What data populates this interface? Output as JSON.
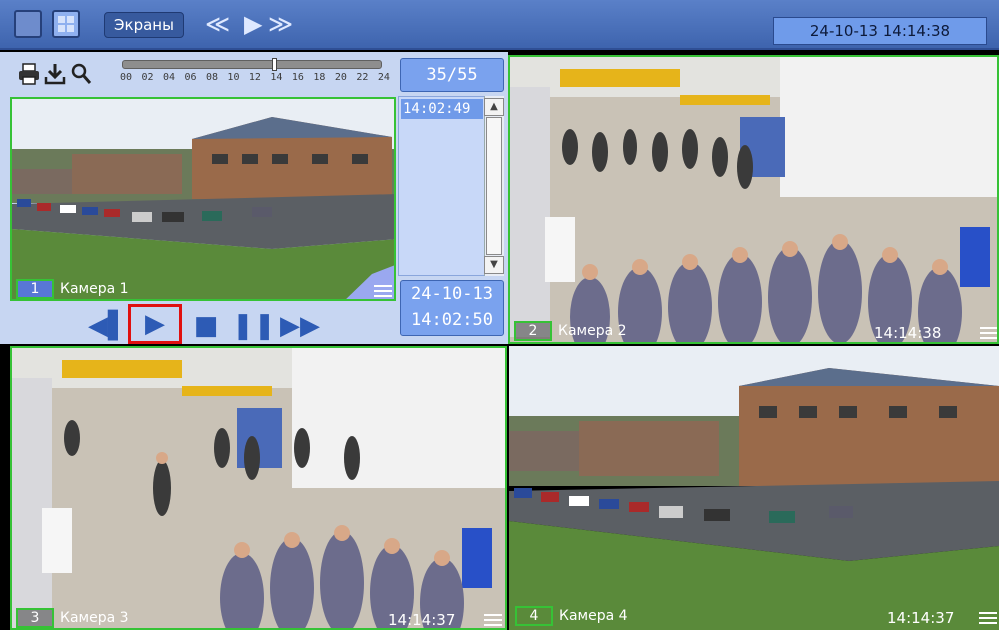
{
  "toolbar": {
    "screens_label": "Экраны",
    "datetime": "24-10-13  14:14:38"
  },
  "playback": {
    "counter": "35/55",
    "timeline_ticks": [
      "00",
      "02",
      "04",
      "06",
      "08",
      "10",
      "12",
      "14",
      "16",
      "18",
      "20",
      "22",
      "24"
    ],
    "list_times": [
      "14:02:49"
    ],
    "play_date": "24-10-13",
    "play_time": "14:02:50",
    "progress_fraction": 0.58
  },
  "cameras": [
    {
      "num": "1",
      "name": "Камера 1",
      "time": ""
    },
    {
      "num": "2",
      "name": "Камера 2",
      "time": "14:14:38"
    },
    {
      "num": "3",
      "name": "Камера 3",
      "time": "14:14:37"
    },
    {
      "num": "4",
      "name": "Камера 4",
      "time": "14:14:37"
    }
  ],
  "colors": {
    "accent_green": "#36c236",
    "toolbar_blue": "#4a70b8",
    "panel_bg": "#c7d6f2",
    "highlight_red": "#e01010"
  },
  "icons": [
    "single-view-icon",
    "grid-view-icon",
    "rewind-icon",
    "play-icon",
    "fast-forward-icon",
    "print-icon",
    "download-icon",
    "search-icon",
    "menu-icon",
    "step-back-icon",
    "stop-icon",
    "pause-icon",
    "step-forward-icon"
  ]
}
